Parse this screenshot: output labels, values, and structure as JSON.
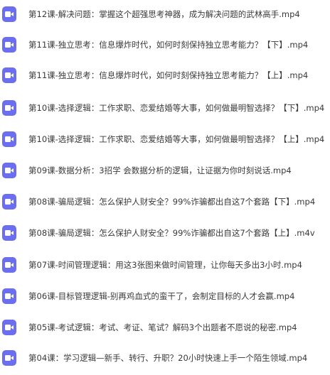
{
  "files": [
    {
      "name": "第12课-解决问题：掌握这个超强思考神器，成为解决问题的武林高手.mp4",
      "icon": "video-file-icon"
    },
    {
      "name": "第11课-独立思考：信息爆炸时代，如何时刻保持独立思考能力？【下】.mp4",
      "icon": "video-file-icon"
    },
    {
      "name": "第11课-独立思考：信息爆炸时代，如何时刻保持独立思考能力？【上】.mp4",
      "icon": "video-file-icon"
    },
    {
      "name": "第10课-选择逻辑：工作求职、恋爱结婚等大事，如何做最明智选择？【下】.mp4",
      "icon": "video-file-icon"
    },
    {
      "name": "第10课-选择逻辑：工作求职、恋爱结婚等大事，如何做最明智选择？【上】.mp4",
      "icon": "video-file-icon"
    },
    {
      "name": "第09课-数据分析：3招学 会数据分析的逻辑，让证据为你时刻说话.mp4",
      "icon": "video-file-icon"
    },
    {
      "name": "第08课-骗局逻辑：怎么保护人财安全？99%诈骗都出自这7个套路【下】.mp4",
      "icon": "video-file-icon"
    },
    {
      "name": "第08课-骗局逻辑：怎么保护人财安全？99%诈骗都出自这7个套路【上】.m4v",
      "icon": "video-file-icon"
    },
    {
      "name": "第07课-时间管理逻辑：用这3张图来做时间管理，让你每天多出3小时.mp4",
      "icon": "video-file-icon"
    },
    {
      "name": "第06课-目标管理逻辑-别再鸡血式的蛮干了，会制定目标的人才会赢.mp4",
      "icon": "video-file-icon"
    },
    {
      "name": "第05课-考试逻辑：考试、考证、笔试？解码3个出题者不愿说的秘密.mp4",
      "icon": "video-file-icon"
    },
    {
      "name": "第04课：学习逻辑—新手、转行、升职？20小时快速上手一个陌生领域.mp4",
      "icon": "video-file-icon"
    }
  ],
  "colors": {
    "icon_bg": "#6c6ef0",
    "text": "#3a3a3a",
    "background": "#ffffff"
  }
}
